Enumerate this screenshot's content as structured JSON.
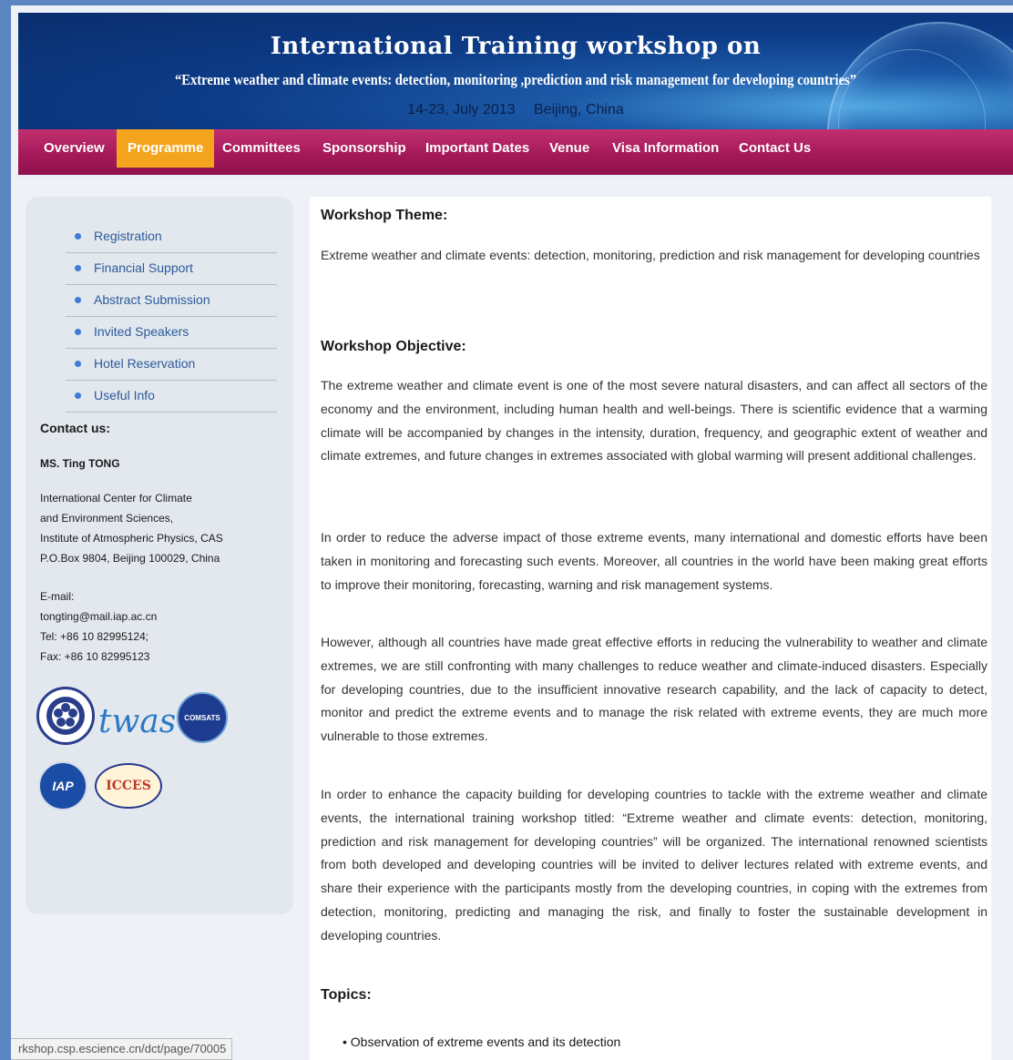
{
  "banner": {
    "title": "International Training workshop on",
    "subtitle": "“Extreme weather and climate events: detection, monitoring ,prediction and risk management for developing countries”",
    "dates": "14-23, July 2013",
    "location": "Beijing, China"
  },
  "nav": {
    "items": [
      {
        "label": "Overview"
      },
      {
        "label": "Programme",
        "active": true
      },
      {
        "label": "Committees"
      },
      {
        "label": "Sponsorship"
      },
      {
        "label": "Important Dates"
      },
      {
        "label": "Venue"
      },
      {
        "label": "Visa Information"
      },
      {
        "label": "Contact Us"
      }
    ]
  },
  "sidebar": {
    "menu": [
      {
        "label": "Registration"
      },
      {
        "label": "Financial Support"
      },
      {
        "label": "Abstract Submission"
      },
      {
        "label": "Invited Speakers"
      },
      {
        "label": "Hotel Reservation"
      },
      {
        "label": "Useful Info"
      }
    ],
    "contact_heading": "Contact us:",
    "contact_name": "MS. Ting TONG",
    "address": [
      "International Center for Climate",
      "and Environment Sciences,",
      "Institute of Atmospheric Physics, CAS",
      "P.O.Box 9804, Beijing 100029, China"
    ],
    "email_label": "E-mail:",
    "email": "tongting@mail.iap.ac.cn",
    "tel": "Tel: +86 10 82995124;",
    "fax": "Fax: +86 10 82995123",
    "logos": {
      "twas": "twas",
      "comsats": "COMSATS",
      "iap": "IAP",
      "icces": "ICCES"
    }
  },
  "content": {
    "theme_heading": "Workshop Theme:",
    "theme_text": "Extreme weather and climate events: detection, monitoring, prediction and risk management for developing countries",
    "objective_heading": "Workshop Objective:",
    "paragraphs": [
      "The extreme weather and climate event is one of the most severe natural disasters, and can affect all sectors of the economy and the environment, including human health and well-beings. There is scientific evidence that a warming climate will be accompanied by changes in the intensity, duration, frequency, and geographic extent of weather and climate extremes, and future changes in extremes associated with global warming will present additional challenges.",
      "In order to reduce the adverse impact of those extreme events, many international and domestic efforts have been taken in monitoring and forecasting such events. Moreover, all countries in the world have been making great efforts to improve their monitoring, forecasting, warning and risk management systems.",
      "However, although all countries have made great effective efforts in reducing the vulnerability to weather and climate extremes, we are still confronting with many challenges to reduce weather and climate-induced disasters. Especially for developing countries, due to the insufficient innovative research capability, and the lack of capacity to detect, monitor and predict the extreme events and to manage the risk related with extreme events, they are much more vulnerable to those extremes.",
      "In order to enhance the capacity building for developing countries to tackle with the extreme weather and climate events, the international training workshop titled: “Extreme weather and climate events: detection, monitoring, prediction and risk management for developing countries” will be organized. The international renowned scientists from both developed and developing countries will be invited to deliver lectures related with extreme events, and share their experience with the participants mostly from the developing countries, in coping with the extremes from detection, monitoring, predicting and managing the risk, and finally to foster the sustainable development in developing countries."
    ],
    "topics_heading": "Topics:",
    "topics": [
      "Observation of extreme events and its detection"
    ]
  },
  "status_bar": {
    "url": "rkshop.csp.escience.cn/dct/page/70005"
  }
}
